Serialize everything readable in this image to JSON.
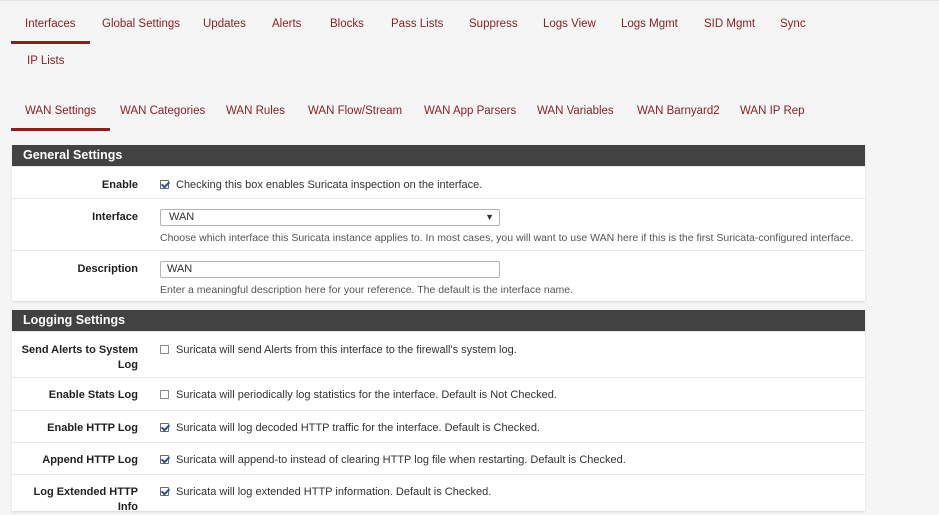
{
  "tabs_top": [
    "Interfaces",
    "Global Settings",
    "Updates",
    "Alerts",
    "Blocks",
    "Pass Lists",
    "Suppress",
    "Logs View",
    "Logs Mgmt",
    "SID Mgmt",
    "Sync",
    "IP Lists"
  ],
  "tabs_sub": [
    "WAN Settings",
    "WAN Categories",
    "WAN Rules",
    "WAN Flow/Stream",
    "WAN App Parsers",
    "WAN Variables",
    "WAN Barnyard2",
    "WAN IP Rep"
  ],
  "general": {
    "heading": "General Settings",
    "enable_label": "Enable",
    "enable_text": "Checking this box enables Suricata inspection on the interface.",
    "interface_label": "Interface",
    "interface_value": "WAN",
    "interface_help": "Choose which interface this Suricata instance applies to. In most cases, you will want to use WAN here if this is the first Suricata-configured interface.",
    "description_label": "Description",
    "description_value": "WAN",
    "description_help": "Enter a meaningful description here for your reference. The default is the interface name."
  },
  "logging": {
    "heading": "Logging Settings",
    "rows": [
      {
        "label": "Send Alerts to System Log",
        "text": "Suricata will send Alerts from this interface to the firewall's system log.",
        "checked": false
      },
      {
        "label": "Enable Stats Log",
        "text": "Suricata will periodically log statistics for the interface. Default is Not Checked.",
        "checked": false
      },
      {
        "label": "Enable HTTP Log",
        "text": "Suricata will log decoded HTTP traffic for the interface. Default is Checked.",
        "checked": true
      },
      {
        "label": "Append HTTP Log",
        "text": "Suricata will append-to instead of clearing HTTP log file when restarting. Default is Checked.",
        "checked": true
      },
      {
        "label": "Log Extended HTTP Info",
        "text": "Suricata will log extended HTTP information. Default is Checked.",
        "checked": true
      }
    ]
  },
  "icons": {
    "dropdown": "caret-down-icon",
    "checkbox": "checkbox-icon"
  }
}
